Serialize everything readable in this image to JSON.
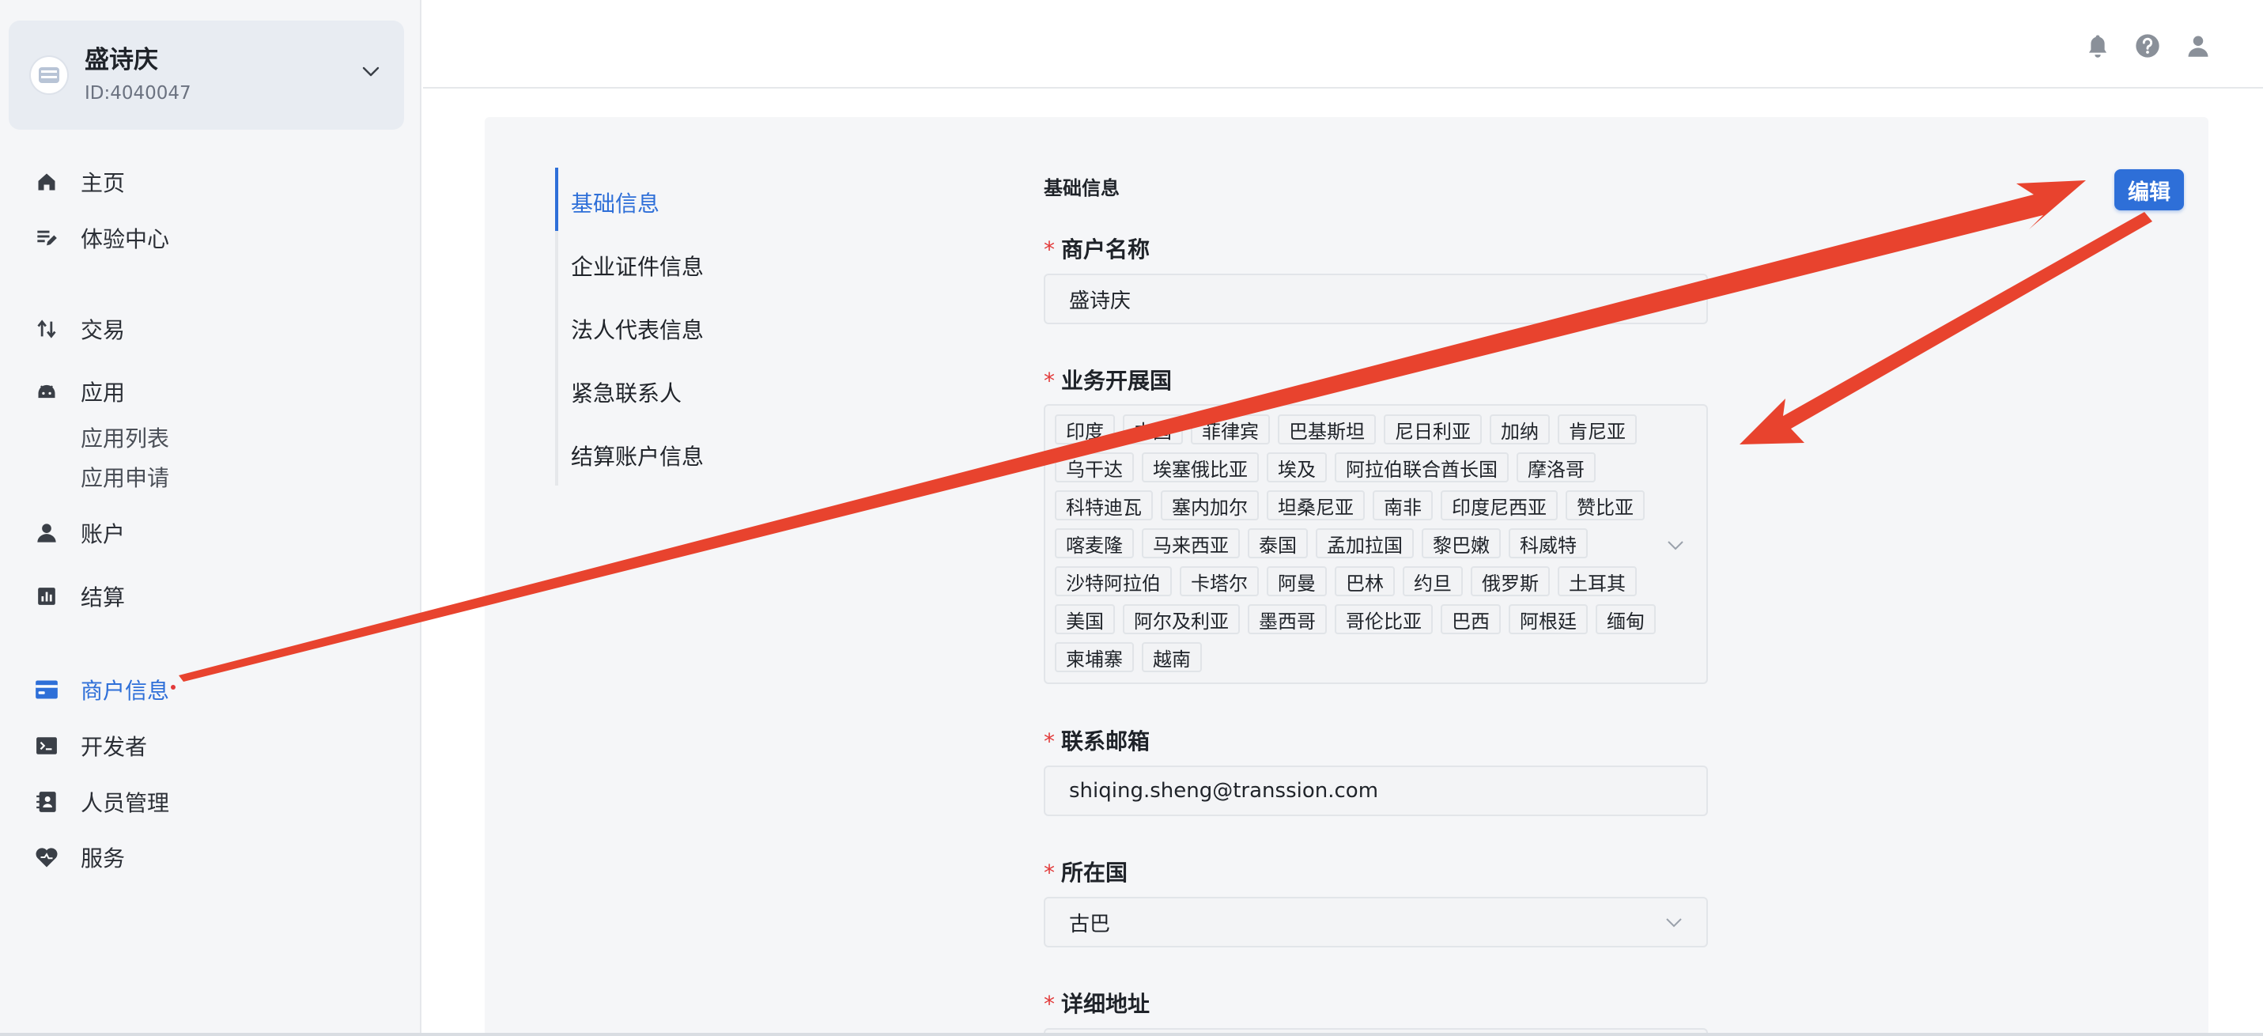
{
  "account": {
    "name": "盛诗庆",
    "id": "ID:4040047"
  },
  "sidebar": {
    "items": [
      {
        "label": "主页",
        "icon": "home-icon"
      },
      {
        "label": "体验中心",
        "icon": "edit-list-icon"
      },
      {
        "label": "交易",
        "icon": "arrows-updown-icon"
      },
      {
        "label": "应用",
        "icon": "android-icon"
      },
      {
        "label": "账户",
        "icon": "person-icon"
      },
      {
        "label": "结算",
        "icon": "bar-chart-icon"
      },
      {
        "label": "商户信息",
        "icon": "merchant-card-icon"
      },
      {
        "label": "开发者",
        "icon": "terminal-icon"
      },
      {
        "label": "人员管理",
        "icon": "contact-card-icon"
      },
      {
        "label": "服务",
        "icon": "heart-icon"
      }
    ],
    "app_subitems": [
      "应用列表",
      "应用申请"
    ],
    "active": "商户信息"
  },
  "header": {
    "icons": [
      "bell-icon",
      "help-icon",
      "user-icon"
    ]
  },
  "subnav": {
    "items": [
      "基础信息",
      "企业证件信息",
      "法人代表信息",
      "紧急联系人",
      "结算账户信息"
    ],
    "active": "基础信息"
  },
  "form": {
    "section_title": "基础信息",
    "edit_label": "编辑",
    "required_mark": "*",
    "merchant_name": {
      "label": "商户名称",
      "value": "盛诗庆"
    },
    "business_countries": {
      "label": "业务开展国",
      "rows": [
        [
          "印度",
          "中国",
          "菲律宾",
          "巴基斯坦",
          "尼日利亚",
          "加纳",
          "肯尼亚"
        ],
        [
          "乌干达",
          "埃塞俄比亚",
          "埃及",
          "阿拉伯联合酋长国",
          "摩洛哥"
        ],
        [
          "科特迪瓦",
          "塞内加尔",
          "坦桑尼亚",
          "南非",
          "印度尼西亚",
          "赞比亚"
        ],
        [
          "喀麦隆",
          "马来西亚",
          "泰国",
          "孟加拉国",
          "黎巴嫩",
          "科威特"
        ],
        [
          "沙特阿拉伯",
          "卡塔尔",
          "阿曼",
          "巴林",
          "约旦",
          "俄罗斯",
          "土耳其"
        ],
        [
          "美国",
          "阿尔及利亚",
          "墨西哥",
          "哥伦比亚",
          "巴西",
          "阿根廷",
          "缅甸"
        ],
        [
          "柬埔寨",
          "越南"
        ]
      ]
    },
    "email": {
      "label": "联系邮箱",
      "value": "shiqing.sheng@transsion.com"
    },
    "country": {
      "label": "所在国",
      "value": "古巴"
    },
    "address": {
      "label": "详细地址"
    }
  },
  "annotation_color": "#e8432e",
  "accent_color": "#2e6fd8"
}
